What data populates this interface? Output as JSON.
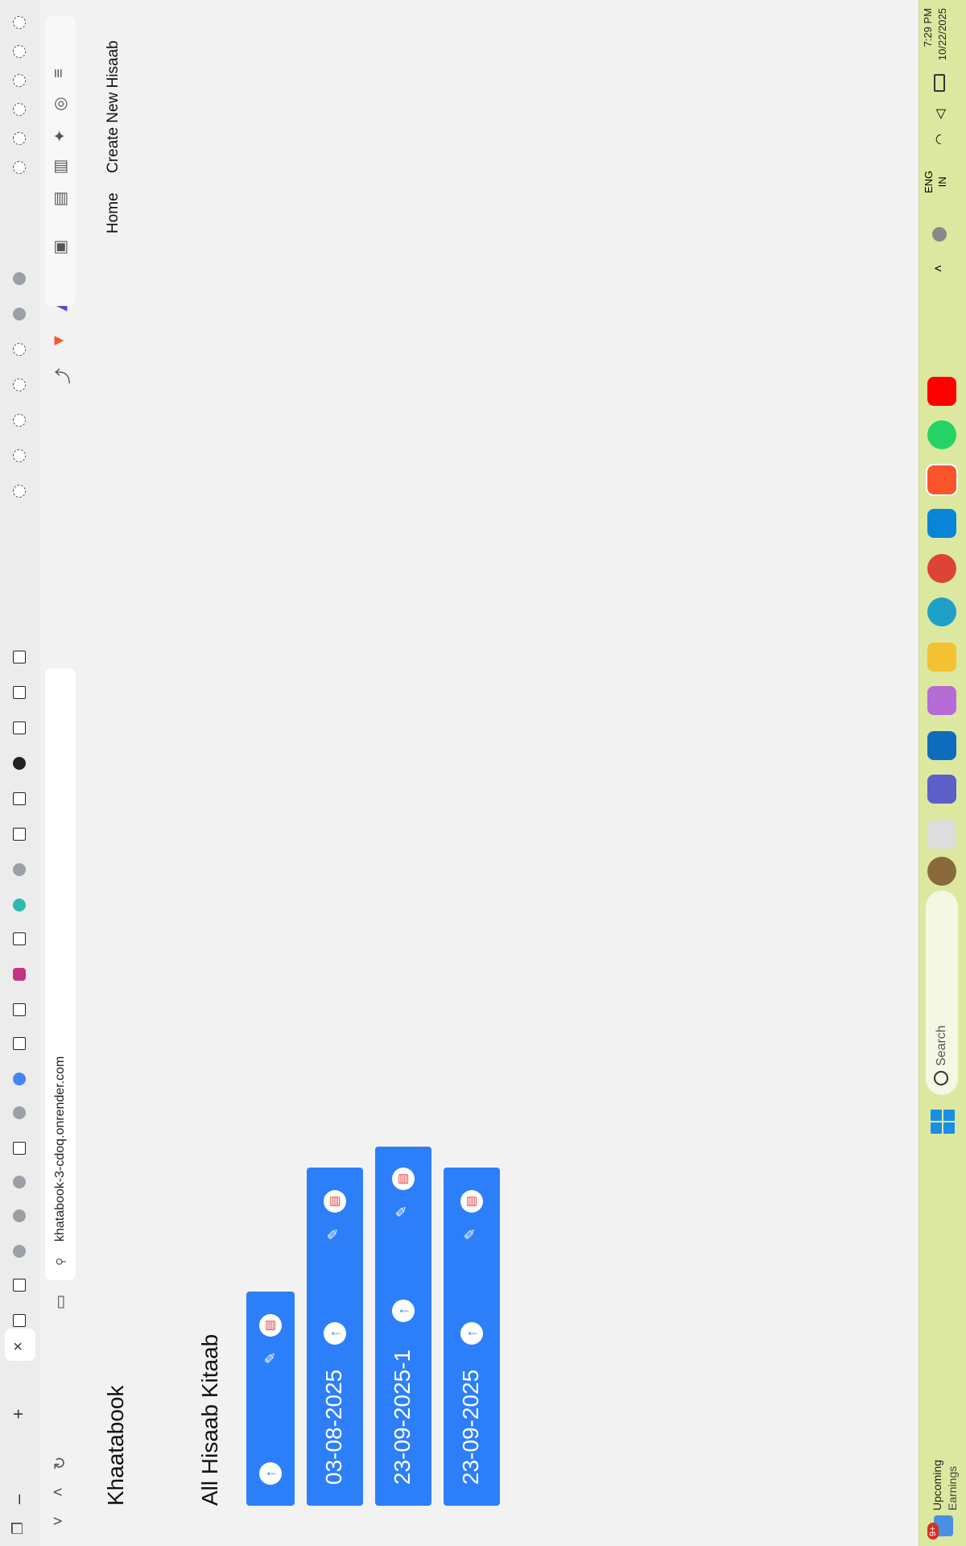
{
  "browser": {
    "url": "khatabook-3-cdoq.onrender.com"
  },
  "page": {
    "brand": "Khaatabook",
    "nav": [
      "Home",
      "Create New Hisaab"
    ],
    "section_title": "All Hisaab Kitaab",
    "cards": [
      {
        "name": ""
      },
      {
        "name": "03-08-2025"
      },
      {
        "name": "23-09-2025-1"
      },
      {
        "name": "23-09-2025"
      }
    ]
  },
  "taskbar": {
    "weather_badge": "9+",
    "weather_line1": "Upcoming",
    "weather_line2": "Earnings",
    "search_placeholder": "Search",
    "lang_line1": "ENG",
    "lang_line2": "IN",
    "time": "7:29 PM",
    "date": "10/22/2025"
  },
  "colors": {
    "accent": "#2d7ff9",
    "taskbar": "#dce8a0",
    "delete": "#e53935"
  }
}
